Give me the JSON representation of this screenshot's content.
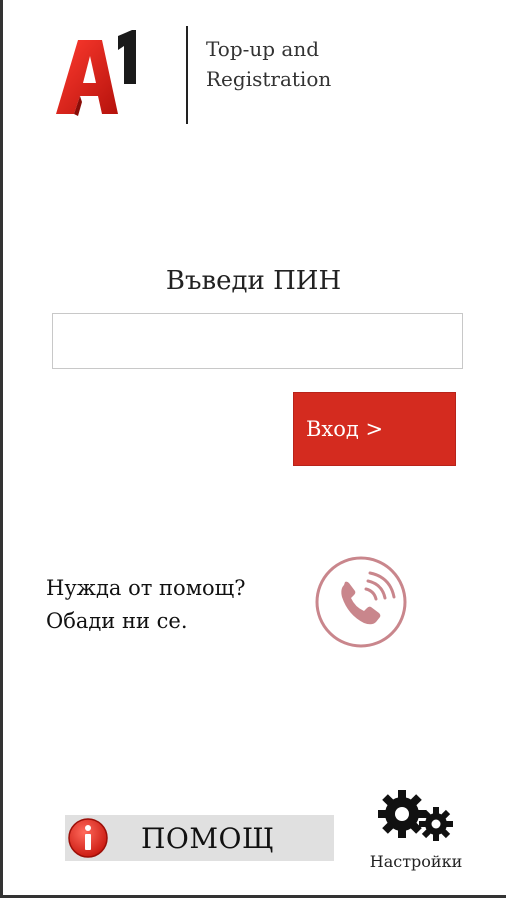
{
  "header": {
    "logo_icon": "a1-logo",
    "title_line1": "Top-up and",
    "title_line2": "Registration"
  },
  "pin": {
    "label": "Въведи ПИН",
    "value": "",
    "placeholder": ""
  },
  "login": {
    "label": "Вход >"
  },
  "help_prompt": {
    "line1": "Нужда от помощ?",
    "line2": "Обади ни се.",
    "call_icon": "phone-call-icon"
  },
  "help_button": {
    "icon": "info-icon",
    "label": "ПОМОЩ"
  },
  "settings": {
    "icon": "gears-icon",
    "label": "Настройки"
  },
  "colors": {
    "brand_red": "#d42b1f",
    "call_ring": "#c9868c",
    "button_gray": "#e0e0e0"
  }
}
